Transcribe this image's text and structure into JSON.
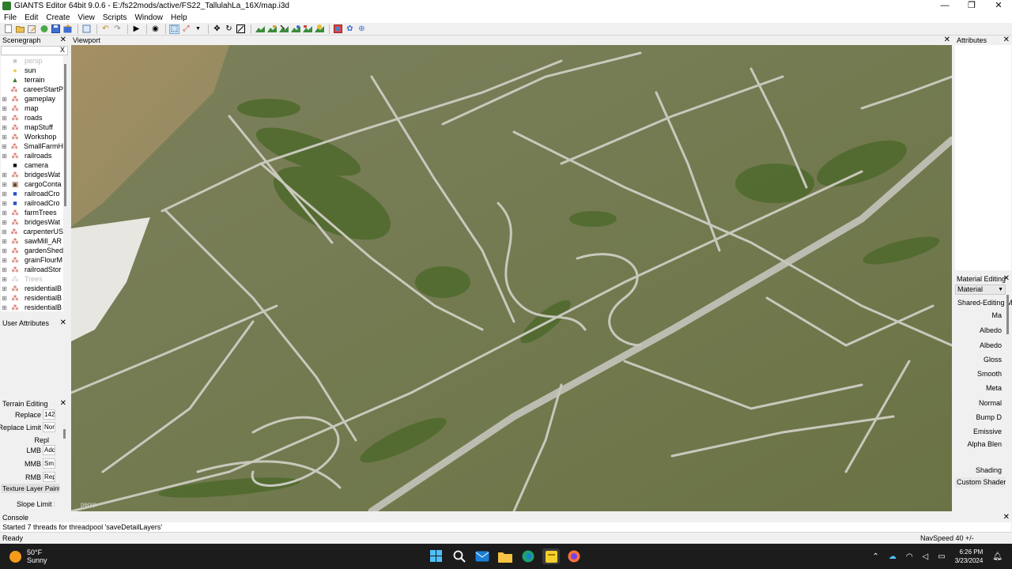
{
  "window": {
    "title": "GIANTS Editor 64bit 9.0.6 - E:/fs22mods/active/FS22_TallulahLa_16X/map.i3d",
    "controls": [
      "—",
      "❐",
      "✕"
    ]
  },
  "menu": [
    "File",
    "Edit",
    "Create",
    "View",
    "Scripts",
    "Window",
    "Help"
  ],
  "toolbar": {
    "icons": [
      "new-icon",
      "open-icon",
      "edit-icon",
      "reload-icon",
      "save-icon",
      "export-icon",
      "undo-history-icon",
      "undo-icon",
      "redo-icon",
      "play-icon",
      "eye-icon",
      "select-icon",
      "terrain-select-icon",
      "move-icon",
      "rotate-icon",
      "scale-icon",
      "paint-terrain-icon",
      "foliage-icon",
      "sculpt-icon",
      "brush-icon",
      "texture-icon",
      "tree-icon",
      "navmesh-icon",
      "settings-icon",
      "globe-icon"
    ]
  },
  "scenegraph": {
    "title": "Scenegraph",
    "close": "✕",
    "search_value": "",
    "search_clear": "X",
    "items": [
      {
        "label": "persp",
        "icon": "camera-icon",
        "expand": "",
        "dim": true
      },
      {
        "label": "sun",
        "icon": "light-icon",
        "expand": "",
        "dim": false
      },
      {
        "label": "terrain",
        "icon": "terrain-icon",
        "expand": "",
        "dim": false
      },
      {
        "label": "careerStartP",
        "icon": "transform-group-icon",
        "expand": "",
        "dim": false
      },
      {
        "label": "gameplay",
        "icon": "transform-group-icon",
        "expand": "⊞",
        "dim": false
      },
      {
        "label": "map",
        "icon": "transform-group-icon",
        "expand": "⊞",
        "dim": false
      },
      {
        "label": "roads",
        "icon": "transform-group-icon",
        "expand": "⊞",
        "dim": false
      },
      {
        "label": "mapStuff",
        "icon": "transform-group-icon",
        "expand": "⊞",
        "dim": false
      },
      {
        "label": "Workshop",
        "icon": "transform-group-icon",
        "expand": "⊞",
        "dim": false
      },
      {
        "label": "SmallFarmH",
        "icon": "transform-group-icon",
        "expand": "⊞",
        "dim": false
      },
      {
        "label": "railroads",
        "icon": "transform-group-icon",
        "expand": "⊞",
        "dim": false
      },
      {
        "label": "camera",
        "icon": "camera-icon",
        "expand": "",
        "dim": false
      },
      {
        "label": "bridgesWat",
        "icon": "transform-group-icon",
        "expand": "⊞",
        "dim": false
      },
      {
        "label": "cargoConta",
        "icon": "shape-icon",
        "expand": "⊞",
        "dim": false
      },
      {
        "label": "railroadCro",
        "icon": "cube-icon",
        "expand": "⊞",
        "dim": false
      },
      {
        "label": "railroadCro",
        "icon": "cube-icon",
        "expand": "⊞",
        "dim": false
      },
      {
        "label": "farmTrees",
        "icon": "transform-group-icon",
        "expand": "⊞",
        "dim": false
      },
      {
        "label": "bridgesWat",
        "icon": "transform-group-icon",
        "expand": "⊞",
        "dim": false
      },
      {
        "label": "carpenterUS",
        "icon": "transform-group-icon",
        "expand": "⊞",
        "dim": false
      },
      {
        "label": "sawMill_AR",
        "icon": "transform-group-icon",
        "expand": "⊞",
        "dim": false
      },
      {
        "label": "gardenShed",
        "icon": "transform-group-icon",
        "expand": "⊞",
        "dim": false
      },
      {
        "label": "grainFlourM",
        "icon": "transform-group-icon",
        "expand": "⊞",
        "dim": false
      },
      {
        "label": "railroadStor",
        "icon": "transform-group-icon",
        "expand": "⊞",
        "dim": false
      },
      {
        "label": "Trees",
        "icon": "transform-group-icon",
        "expand": "⊞",
        "dim": true
      },
      {
        "label": "residentialB",
        "icon": "transform-group-icon",
        "expand": "⊞",
        "dim": false
      },
      {
        "label": "residentialB",
        "icon": "transform-group-icon",
        "expand": "⊞",
        "dim": false
      },
      {
        "label": "residentialB",
        "icon": "transform-group-icon",
        "expand": "⊞",
        "dim": false
      }
    ]
  },
  "user_attributes": {
    "title": "User Attributes",
    "close": "✕"
  },
  "terrain_editing": {
    "title": "Terrain Editing",
    "close": "✕",
    "rows": [
      {
        "label": "Replace",
        "value": "142"
      },
      {
        "label": "Replace Limit",
        "value": "Non"
      },
      {
        "label": "Repl",
        "value": ""
      },
      {
        "label": "LMB",
        "value": "Add"
      },
      {
        "label": "MMB",
        "value": "Sm"
      },
      {
        "label": "RMB",
        "value": "Rep"
      }
    ],
    "texture_layer_label": "Texture Layer Paint",
    "slope_limit_label": "Slope Limit St"
  },
  "viewport": {
    "title": "Viewport",
    "close": "✕",
    "camera_label": "persp"
  },
  "attributes": {
    "title": "Attributes",
    "close": "✕"
  },
  "material_editing": {
    "title": "Material Editing",
    "close": "✕",
    "dropdown": "Material",
    "labels": [
      "Shared-Editing M",
      "Ma",
      "Albedo",
      "Albedo",
      "Gloss",
      "Smooth",
      "Meta",
      "Normal",
      "Bump D",
      "Emissive",
      "Alpha Blen",
      "Shading"
    ],
    "footer": "Custom Shaders"
  },
  "console": {
    "title": "Console",
    "close": "✕",
    "log": "Started 7 threads for threadpool 'saveDetailLayers'"
  },
  "status": {
    "ready": "Ready",
    "navspeed": "NavSpeed 40 +/-"
  },
  "taskbar": {
    "temperature": "50°F",
    "condition": "Sunny",
    "time": "6:26 PM",
    "date": "3/23/2024",
    "apps": [
      "windows-start-icon",
      "search-icon",
      "mail-icon",
      "folder-icon",
      "edge-icon",
      "sticky-notes-icon",
      "firefox-icon"
    ],
    "tray": [
      "chevron-up-icon",
      "onedrive-icon",
      "wifi-icon",
      "volume-icon",
      "battery-icon",
      "notification-icon"
    ]
  },
  "colors": {
    "terrain_base": "#747a52",
    "road": "#c9c8bc",
    "tree": "#4f6a2c",
    "accent": "#0078d4"
  }
}
